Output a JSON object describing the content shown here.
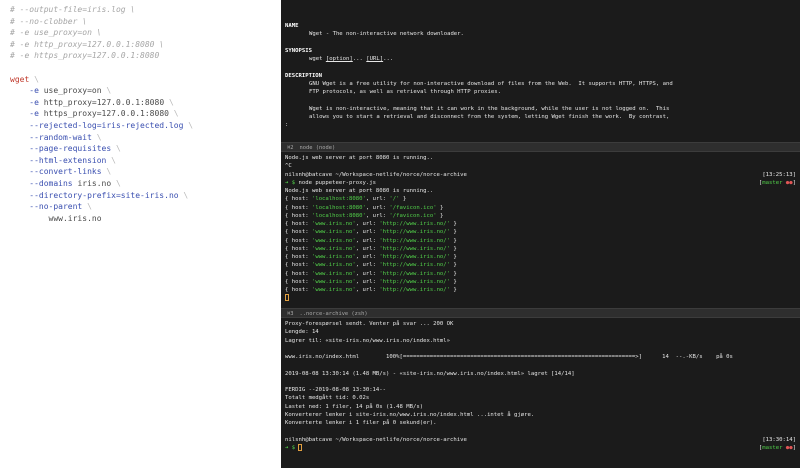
{
  "editor": {
    "lines": [
      {
        "type": "comment",
        "text": "# --output-file=iris.log \\"
      },
      {
        "type": "comment",
        "text": "# --no-clobber \\"
      },
      {
        "type": "comment",
        "text": "# -e use_proxy=on \\"
      },
      {
        "type": "comment",
        "text": "# -e http_proxy=127.0.0.1:8080 \\"
      },
      {
        "type": "comment",
        "text": "# -e https_proxy=127.0.0.1:8080"
      },
      {
        "type": "blank",
        "text": ""
      },
      {
        "type": "cmd",
        "text": "wget",
        "bs": " \\"
      },
      {
        "type": "opt",
        "indent": "    ",
        "flag": "-e",
        "val": " use_proxy=on",
        "bs": " \\"
      },
      {
        "type": "opt",
        "indent": "    ",
        "flag": "-e",
        "val": " http_proxy=127.0.0.1:8080",
        "bs": " \\"
      },
      {
        "type": "opt",
        "indent": "    ",
        "flag": "-e",
        "val": " https_proxy=127.0.0.1:8080",
        "bs": " \\"
      },
      {
        "type": "opt",
        "indent": "    ",
        "flag": "--rejected-log=iris-rejected.log",
        "val": "",
        "bs": " \\"
      },
      {
        "type": "opt",
        "indent": "    ",
        "flag": "--random-wait",
        "val": "",
        "bs": " \\"
      },
      {
        "type": "opt",
        "indent": "    ",
        "flag": "--page-requisites",
        "val": "",
        "bs": " \\"
      },
      {
        "type": "opt",
        "indent": "    ",
        "flag": "--html-extension",
        "val": "",
        "bs": " \\"
      },
      {
        "type": "opt",
        "indent": "    ",
        "flag": "--convert-links",
        "val": "",
        "bs": " \\"
      },
      {
        "type": "opt",
        "indent": "    ",
        "flag": "--domains",
        "val": " iris.no",
        "bs": " \\"
      },
      {
        "type": "opt",
        "indent": "    ",
        "flag": "--directory-prefix=site-iris.no",
        "val": "",
        "bs": " \\"
      },
      {
        "type": "opt",
        "indent": "    ",
        "flag": "--no-parent",
        "val": "",
        "bs": " \\"
      },
      {
        "type": "plain",
        "text": "        www.iris.no"
      }
    ]
  },
  "man_pane": {
    "name_heading": "NAME",
    "name_text": "Wget - The non-interactive network downloader.",
    "synopsis_heading": "SYNOPSIS",
    "synopsis_cmd": "wget ",
    "synopsis_opt": "[option]",
    "synopsis_mid": "... ",
    "synopsis_url": "[URL]",
    "synopsis_end": "...",
    "description_heading": "DESCRIPTION",
    "desc_1": "GNU Wget is a free utility for non-interactive download of files from the Web.  It supports HTTP, HTTPS, and",
    "desc_2": "FTP protocols, as well as retrieval through HTTP proxies.",
    "desc_3": "Wget is non-interactive, meaning that it can work in the background, while the user is not logged on.  This",
    "desc_4": "allows you to start a retrieval and disconnect from the system, letting Wget finish the work.  By contrast,",
    "prompt": ":"
  },
  "node_pane": {
    "tab_label": "⌘2",
    "tab_title": "node (node)",
    "line_1": "Node.js web server at port 8080 is running..",
    "line_2": "^C",
    "path_line": "nilsnh@batcave ~/Workspace-netlife/norce/norce-archive",
    "time": "[13:25:13]",
    "prompt_arrow": "➜ $",
    "command": " node puppeteer-proxy.js",
    "git_open": "[",
    "git_branch": "master",
    "git_marks": " ●●",
    "git_close": "]",
    "line_3": "Node.js web server at port 8080 is running..",
    "requests": [
      {
        "host": "'localhost:8080'",
        "url": "'/'"
      },
      {
        "host": "'localhost:8080'",
        "url": "'/favicon.ico'"
      },
      {
        "host": "'localhost:8080'",
        "url": "'/favicon.ico'"
      },
      {
        "host": "'www.iris.no'",
        "url": "'http://www.iris.no/'"
      },
      {
        "host": "'www.iris.no'",
        "url": "'http://www.iris.no/'"
      },
      {
        "host": "'www.iris.no'",
        "url": "'http://www.iris.no/'"
      },
      {
        "host": "'www.iris.no'",
        "url": "'http://www.iris.no/'"
      },
      {
        "host": "'www.iris.no'",
        "url": "'http://www.iris.no/'"
      },
      {
        "host": "'www.iris.no'",
        "url": "'http://www.iris.no/'"
      },
      {
        "host": "'www.iris.no'",
        "url": "'http://www.iris.no/'"
      },
      {
        "host": "'www.iris.no'",
        "url": "'http://www.iris.no/'"
      },
      {
        "host": "'www.iris.no'",
        "url": "'http://www.iris.no/'"
      }
    ],
    "req_prefix": "{ host: ",
    "req_mid": ", url: ",
    "req_suffix": " }"
  },
  "zsh_pane": {
    "tab_label": "⌘3",
    "tab_title": "..norce-archive (zsh)",
    "line_1": "Proxy-forespørsel sendt. Venter på svar ... 200 OK",
    "line_2": "Lengde: 14",
    "line_3": "Lagrer til: «site-iris.no/www.iris.no/index.html»",
    "progress_line": "www.iris.no/index.html        100%[=====================================================================>]      14  --.-KB/s    på 0s",
    "line_4": "2019-08-08 13:30:14 (1.48 MB/s) - «site-iris.no/www.iris.no/index.html» lagret [14/14]",
    "line_5": "FERDIG --2019-08-08 13:30:14--",
    "line_6": "Totalt medgått tid: 0.02s",
    "line_7": "Lastet ned: 1 filer, 14 på 0s (1.48 MB/s)",
    "line_8": "Konverterer lenker i site-iris.no/www.iris.no/index.html ...intet å gjøre.",
    "line_9": "Konverterte lenker i 1 filer på 0 sekund(er).",
    "path_line": "nilsnh@batcave ~/Workspace-netlife/norce/norce-archive",
    "time": "[13:30:14]",
    "prompt_arrow": "➜ $",
    "git_open": "[",
    "git_branch": "master",
    "git_marks": " ●●",
    "git_close": "]"
  },
  "colors": {
    "editor_bg": "#ffffff",
    "terminal_bg": "#1b1b1b",
    "accent_green": "#52d04a",
    "accent_yellow": "#e2d34a"
  }
}
